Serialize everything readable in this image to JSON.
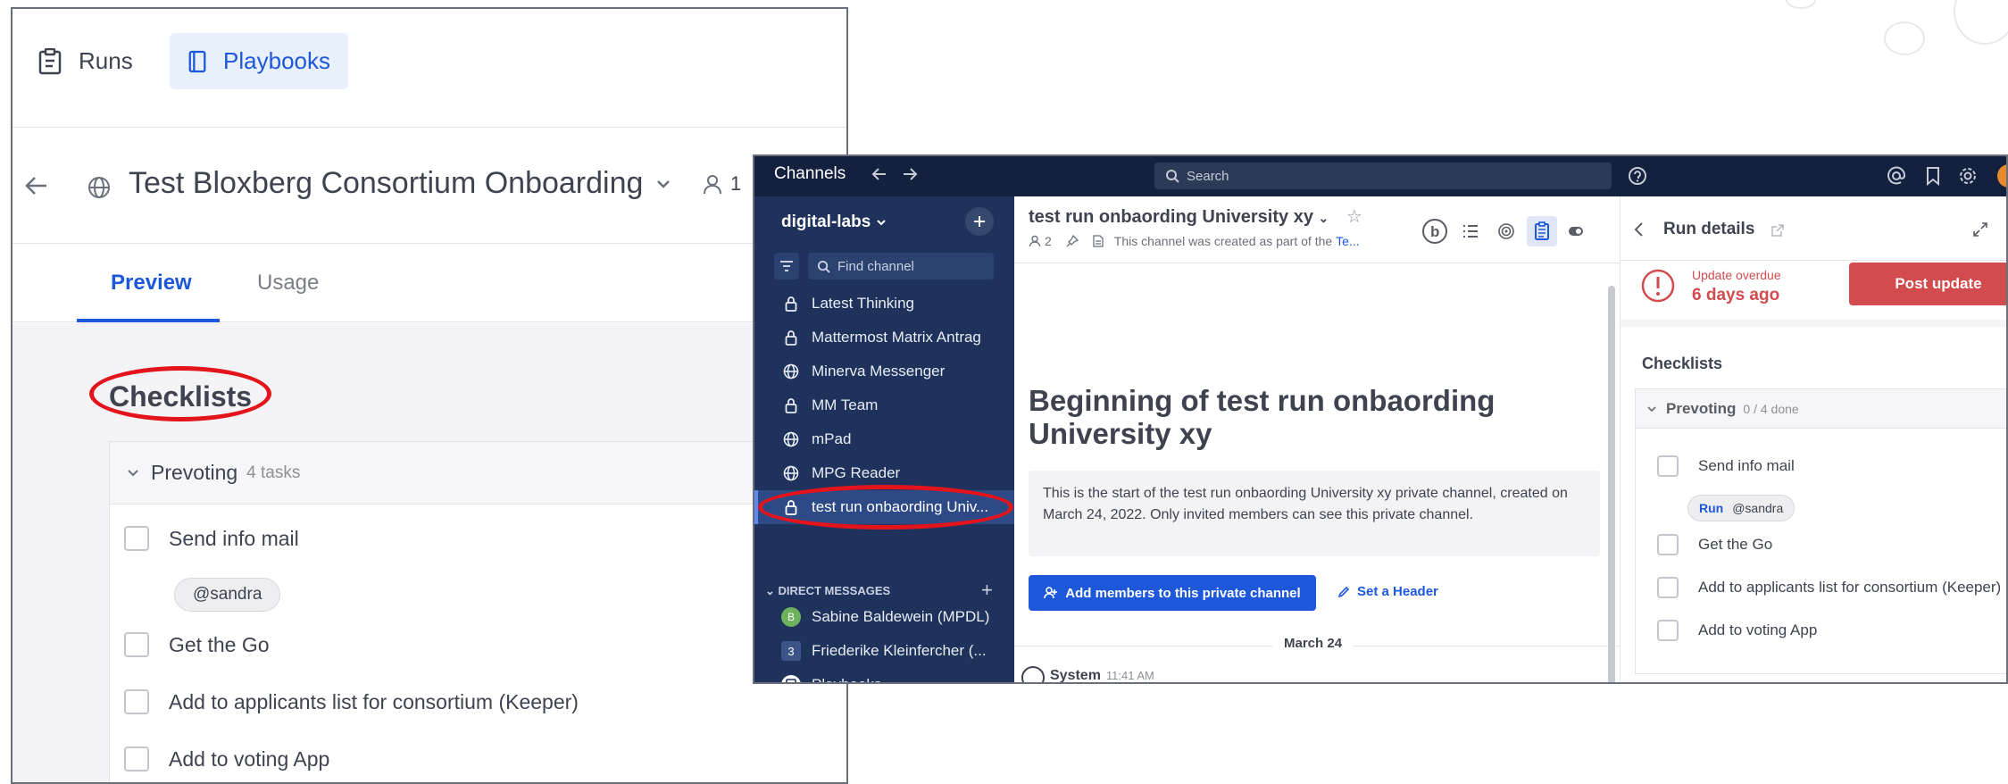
{
  "playbooks_panel": {
    "nav": {
      "runs_label": "Runs",
      "playbooks_label": "Playbooks"
    },
    "title": "Test Bloxberg Consortium Onboarding",
    "members_count": "1",
    "tabs": [
      {
        "label": "Preview",
        "active": true
      },
      {
        "label": "Usage",
        "active": false
      }
    ],
    "checklists_title": "Checklists",
    "checklist": {
      "name": "Prevoting",
      "count": "4 tasks",
      "items": [
        "Send info mail",
        "Get the Go",
        "Add to applicants list for consortium (Keeper)",
        "Add to voting App"
      ],
      "assignee": "@sandra"
    }
  },
  "mattermost": {
    "topbar": {
      "brand": "Channels",
      "search_placeholder": "Search"
    },
    "team": {
      "name": "digital-labs"
    },
    "find_channel": "Find channel",
    "channels": [
      {
        "name": "Latest Thinking",
        "icon": "lock-icon"
      },
      {
        "name": "Mattermost Matrix Antrag",
        "icon": "lock-icon"
      },
      {
        "name": "Minerva Messenger",
        "icon": "globe-icon"
      },
      {
        "name": "MM Team",
        "icon": "lock-icon"
      },
      {
        "name": "mPad",
        "icon": "globe-icon"
      },
      {
        "name": "MPG Reader",
        "icon": "globe-icon"
      },
      {
        "name": "test run onbaording Univ...",
        "icon": "lock-icon",
        "active": true
      }
    ],
    "direct_messages": {
      "title": "DIRECT MESSAGES",
      "items": [
        {
          "name": "Sabine Baldewein (MPDL)",
          "avatar": "B"
        },
        {
          "name": "Friederike Kleinfercher (...",
          "badge": "3"
        },
        {
          "name": "Playbooks"
        }
      ]
    },
    "channel": {
      "name": "test run onbaording University xy",
      "members": "2",
      "description": "This channel was created as part of the",
      "description_link": "Te...",
      "intro_title": "Beginning of test run onbaording University xy",
      "intro_text": "This is the start of the test run onbaording University xy private channel, created on March 24, 2022. Only invited members can see this private channel.",
      "add_members_label": "Add members to this private channel",
      "set_header_label": "Set a Header",
      "date": "March 24",
      "post_author": "System",
      "post_time": "11:41 AM"
    },
    "rhs": {
      "title": "Run details",
      "overdue_label": "Update overdue",
      "overdue_value": "6 days ago",
      "post_update_label": "Post update",
      "checklists_title": "Checklists",
      "checklist": {
        "name": "Prevoting",
        "count": "0 / 4 done",
        "items": [
          "Send info mail",
          "Get the Go",
          "Add to applicants list for consortium (Keeper)",
          "Add to voting App"
        ],
        "run_label": "Run",
        "assignee": "@sandra"
      }
    },
    "colors": {
      "sidebar": "#1e325c",
      "topbar": "#14213e",
      "accent": "#1c58d9",
      "danger": "#d24b4e",
      "highlight": "#e3141b"
    }
  }
}
